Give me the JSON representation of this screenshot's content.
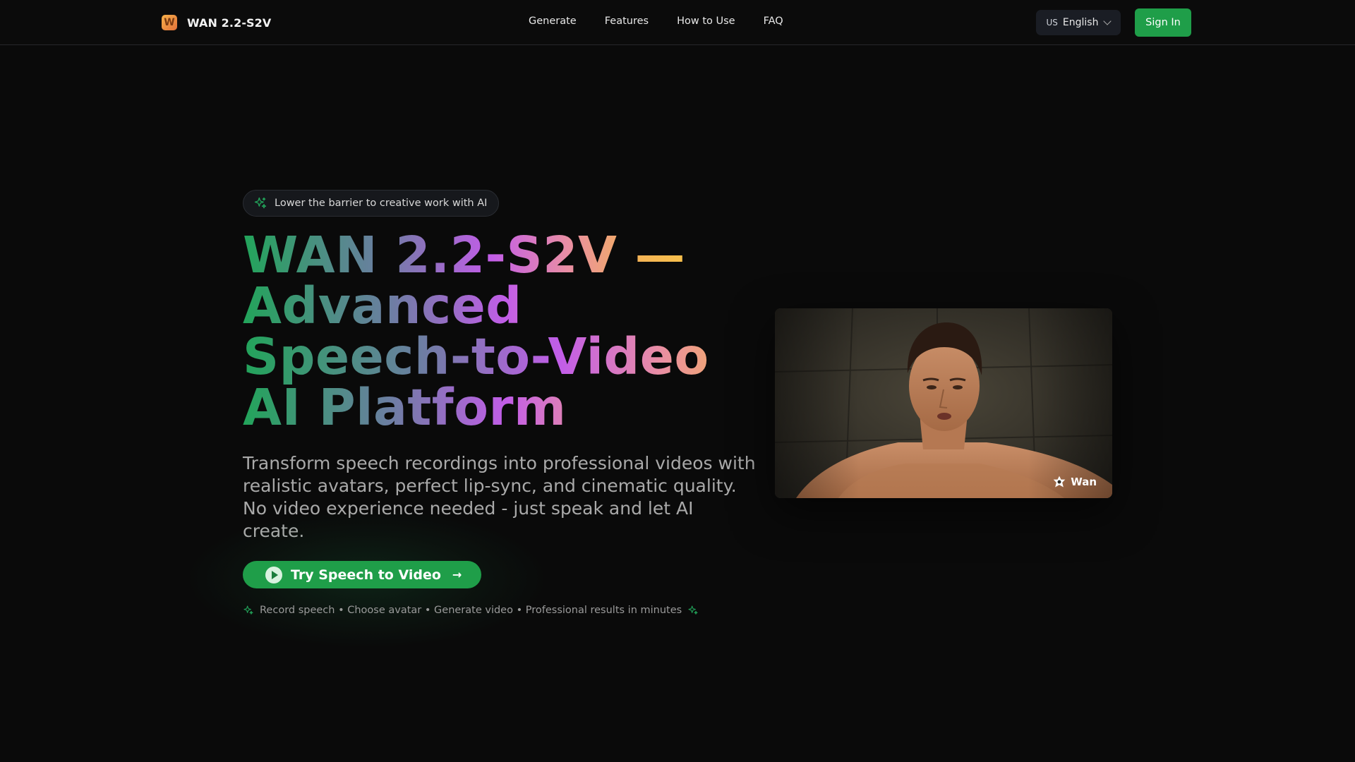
{
  "header": {
    "brand_logo_letter": "W",
    "brand_name": "WAN 2.2-S2V",
    "nav": [
      "Generate",
      "Features",
      "How to Use",
      "FAQ"
    ],
    "language_flag": "US",
    "language_label": "English",
    "signin_label": "Sign In"
  },
  "hero": {
    "badge_text": "Lower the barrier to creative work with AI",
    "headline_lines": [
      "WAN 2.2-S2V —",
      "Advanced",
      "Speech-to-Video",
      "AI Platform"
    ],
    "subtitle": "Transform speech recordings into professional videos with realistic avatars, perfect lip-sync, and cinematic quality. No video experience needed - just speak and let AI create.",
    "cta_label": "Try Speech to Video",
    "steps_text": "Record speech • Choose avatar • Generate video • Professional results in minutes",
    "video_watermark": "Wan"
  },
  "colors": {
    "accent": "#1f9e49",
    "background": "#0a0a0a",
    "gradient": [
      "#22a45a",
      "#6a7fa0",
      "#c25de8",
      "#e98ea4",
      "#f4b455"
    ]
  },
  "icons": {
    "badge": "sparkles-icon",
    "cta_play": "play-icon",
    "cta_arrow": "arrow-right-icon",
    "language_chevron": "chevron-down-icon"
  }
}
